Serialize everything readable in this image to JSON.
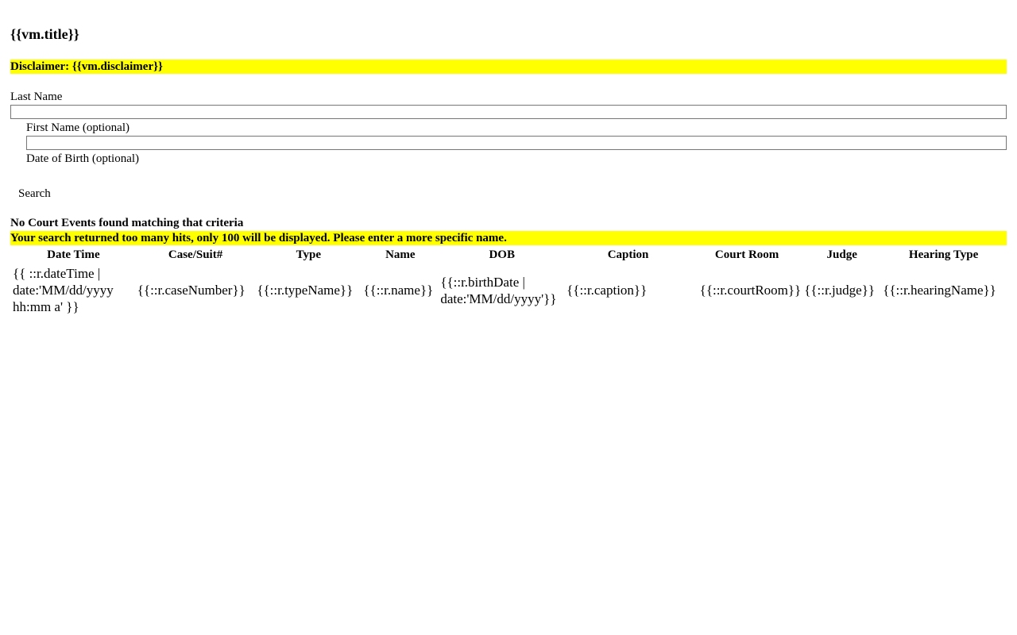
{
  "page": {
    "title": "{{vm.title}}",
    "disclaimer": "Disclaimer: {{vm.disclaimer}}"
  },
  "form": {
    "last_name_label": "Last Name",
    "first_name_label": "First Name (optional)",
    "dob_label": "Date of Birth (optional)",
    "last_name_value": "",
    "first_name_value": "",
    "search_label": "Search"
  },
  "messages": {
    "no_results": "No Court Events found matching that criteria",
    "too_many": "Your search returned too many hits, only 100 will be displayed. Please enter a more specific name."
  },
  "table": {
    "headers": [
      "Date Time",
      "Case/Suit#",
      "Type",
      "Name",
      "DOB",
      "Caption",
      "Court Room",
      "Judge",
      "Hearing Type"
    ],
    "rows": [
      [
        "{{ ::r.dateTime | date:'MM/dd/yyyy hh:mm a' }}",
        "{{::r.caseNumber}}",
        "{{::r.typeName}}",
        "{{::r.name}}",
        "{{::r.birthDate | date:'MM/dd/yyyy'}}",
        "{{::r.caption}}",
        "{{::r.courtRoom}}",
        "{{::r.judge}}",
        "{{::r.hearingName}}"
      ]
    ]
  },
  "colors": {
    "highlight": "#ffff00",
    "text": "#000000",
    "input_border": "#767676"
  }
}
